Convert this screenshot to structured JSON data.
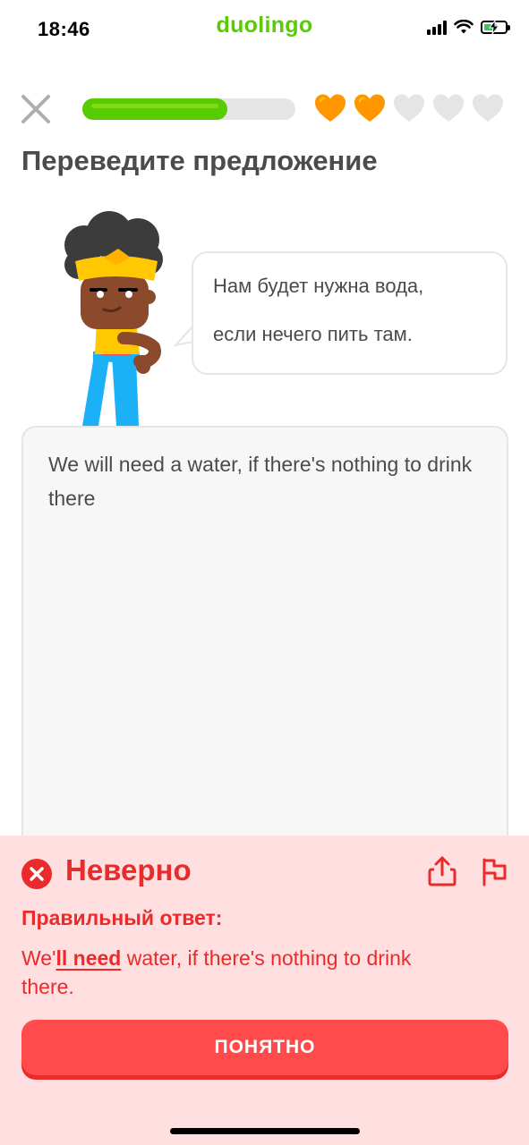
{
  "status_bar": {
    "time": "18:46",
    "app_name": "duolingo",
    "icons": [
      "signal-icon",
      "wifi-icon",
      "battery-charging-icon"
    ]
  },
  "lesson": {
    "progress": 0.68,
    "hearts_total": 5,
    "hearts_filled": 2,
    "title": "Переведите предложение"
  },
  "prompt": {
    "line1": "Нам будет нужна вода,",
    "line2": "если нечего пить там."
  },
  "answer": {
    "text": "We will need a water, if there's nothing to drink there"
  },
  "feedback": {
    "status": "Неверно",
    "correct_label": "Правильный ответ:",
    "correct_prefix": "We'",
    "correct_highlight": "ll need",
    "correct_suffix": " water, if there's nothing to drink there.",
    "button_label": "ПОНЯТНО"
  },
  "colors": {
    "brand_green": "#58cc02",
    "heart_orange": "#ff9600",
    "heart_empty": "#e5e5e5",
    "error_red": "#ea2b2b",
    "error_background": "#ffdfe0",
    "button_red": "#ff4b4b"
  }
}
